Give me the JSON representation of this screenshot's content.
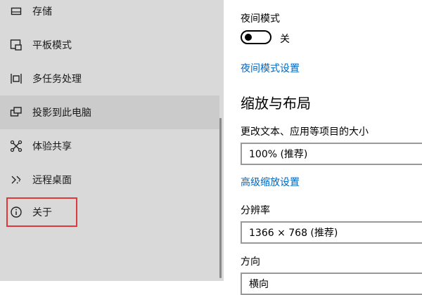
{
  "sidebar": {
    "items": [
      {
        "label": "存储",
        "icon": "storage-icon"
      },
      {
        "label": "平板模式",
        "icon": "tablet-mode-icon"
      },
      {
        "label": "多任务处理",
        "icon": "multitasking-icon"
      },
      {
        "label": "投影到此电脑",
        "icon": "projecting-icon"
      },
      {
        "label": "体验共享",
        "icon": "shared-experiences-icon"
      },
      {
        "label": "远程桌面",
        "icon": "remote-desktop-icon"
      },
      {
        "label": "关于",
        "icon": "info-icon"
      }
    ],
    "selected_index": 3,
    "highlighted_index": 6
  },
  "display": {
    "night_light": {
      "label": "夜间模式",
      "state": "关"
    },
    "night_light_settings_link": "夜间模式设置",
    "scale_section_title": "缩放与布局",
    "scale_label": "更改文本、应用等项目的大小",
    "scale_value": "100% (推荐)",
    "advanced_scaling_link": "高级缩放设置",
    "resolution_label": "分辨率",
    "resolution_value": "1366 × 768 (推荐)",
    "orientation_label": "方向",
    "orientation_value": "横向"
  },
  "colors": {
    "accent": "#0067c0",
    "highlight_border": "#e0393c",
    "sidebar_bg": "#d9d9d9"
  }
}
